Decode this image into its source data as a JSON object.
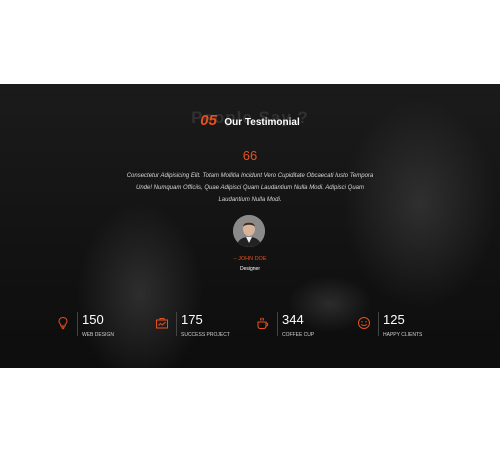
{
  "testimonial": {
    "number": "05",
    "heading": "Our Testimonial",
    "watermark": "People Say ?",
    "quote_mark": "66",
    "quote_lines": [
      "Consectetur Adipisicing Elit. Totam Mollitia Incidunt Vero Cupiditate Obcaecati Iusto Tempora",
      "Unde! Numquam Officiis, Quae Adipisci Quam Laudantium Nulla Modi. Adipisci Quam",
      "Laudantium Nulla Modi."
    ],
    "author_name": "– JOHN DOE",
    "author_role": "Designer"
  },
  "stats": [
    {
      "value": "150",
      "label": "WEB DESIGN",
      "icon": "lightbulb-icon"
    },
    {
      "value": "175",
      "label": "SUCCESS PROJECT",
      "icon": "briefcase-icon"
    },
    {
      "value": "344",
      "label": "COFFEE CUP",
      "icon": "coffee-cup-icon"
    },
    {
      "value": "125",
      "label": "HAPPY CLIENTS",
      "icon": "smiley-icon"
    }
  ],
  "colors": {
    "accent": "#e8501e",
    "background": "#151515"
  }
}
